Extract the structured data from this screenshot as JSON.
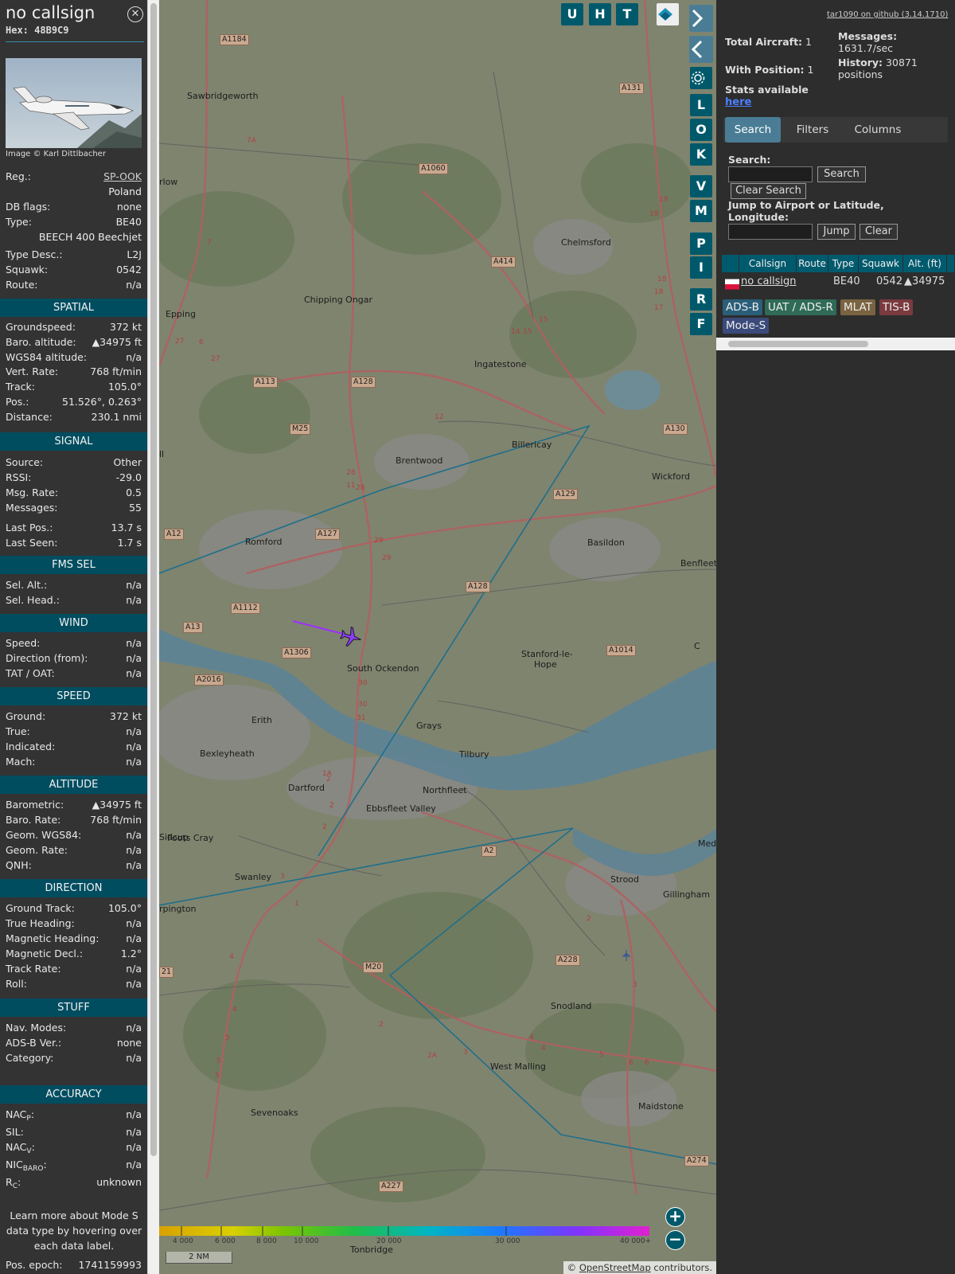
{
  "info": {
    "callsign": "no callsign",
    "hex_label": "Hex:",
    "hex_value": "48B9C9",
    "image_credit": "Image © Karl Dittlbacher",
    "reg_label": "Reg.:",
    "reg_value": "SP-OOK",
    "country": "Poland",
    "dbflags_label": "DB flags:",
    "dbflags_value": "none",
    "type_label": "Type:",
    "type_value": "BE40",
    "type_full": "BEECH 400 Beechjet",
    "typedesc_label": "Type Desc.:",
    "typedesc_value": "L2J",
    "squawk_label": "Squawk:",
    "squawk_value": "0542",
    "route_label": "Route:",
    "route_value": "n/a",
    "sections": {
      "spatial": "SPATIAL",
      "signal": "SIGNAL",
      "fms": "FMS SEL",
      "wind": "WIND",
      "speed": "SPEED",
      "altitude": "ALTITUDE",
      "direction": "DIRECTION",
      "stuff": "STUFF",
      "accuracy": "ACCURACY"
    },
    "spatial": [
      {
        "k": "Groundspeed:",
        "v": "372 kt"
      },
      {
        "k": "Baro. altitude:",
        "v": "▲34975 ft"
      },
      {
        "k": "WGS84 altitude:",
        "v": "n/a"
      },
      {
        "k": "Vert. Rate:",
        "v": "768 ft/min"
      },
      {
        "k": "Track:",
        "v": "105.0°"
      },
      {
        "k": "Pos.:",
        "v": "51.526°, 0.263°"
      },
      {
        "k": "Distance:",
        "v": "230.1 nmi"
      }
    ],
    "signal": [
      {
        "k": "Source:",
        "v": "Other"
      },
      {
        "k": "RSSI:",
        "v": "-29.0"
      },
      {
        "k": "Msg. Rate:",
        "v": "0.5"
      },
      {
        "k": "Messages:",
        "v": "55"
      },
      {
        "k": "Last Pos.:",
        "v": "13.7 s"
      },
      {
        "k": "Last Seen:",
        "v": "1.7 s"
      }
    ],
    "fms": [
      {
        "k": "Sel. Alt.:",
        "v": "n/a"
      },
      {
        "k": "Sel. Head.:",
        "v": "n/a"
      }
    ],
    "wind": [
      {
        "k": "Speed:",
        "v": "n/a"
      },
      {
        "k": "Direction (from):",
        "v": "n/a"
      },
      {
        "k": "TAT / OAT:",
        "v": "n/a"
      }
    ],
    "speed": [
      {
        "k": "Ground:",
        "v": "372 kt"
      },
      {
        "k": "True:",
        "v": "n/a"
      },
      {
        "k": "Indicated:",
        "v": "n/a"
      },
      {
        "k": "Mach:",
        "v": "n/a"
      }
    ],
    "altitude": [
      {
        "k": "Barometric:",
        "v": "▲34975 ft"
      },
      {
        "k": "Baro. Rate:",
        "v": "768 ft/min"
      },
      {
        "k": "Geom. WGS84:",
        "v": "n/a"
      },
      {
        "k": "Geom. Rate:",
        "v": "n/a"
      },
      {
        "k": "QNH:",
        "v": "n/a"
      }
    ],
    "direction": [
      {
        "k": "Ground Track:",
        "v": "105.0°"
      },
      {
        "k": "True Heading:",
        "v": "n/a"
      },
      {
        "k": "Magnetic Heading:",
        "v": "n/a"
      },
      {
        "k": "Magnetic Decl.:",
        "v": "1.2°"
      },
      {
        "k": "Track Rate:",
        "v": "n/a"
      },
      {
        "k": "Roll:",
        "v": "n/a"
      }
    ],
    "stuff": [
      {
        "k": "Nav. Modes:",
        "v": "n/a"
      },
      {
        "k": "ADS-B Ver.:",
        "v": "none"
      },
      {
        "k": "Category:",
        "v": "n/a"
      }
    ],
    "accuracy": {
      "nacp_base": "NAC",
      "nacp_sub": "P",
      "nacp_value": "n/a",
      "sil_label": "SIL:",
      "sil_value": "n/a",
      "nacv_base": "NAC",
      "nacv_sub": "V",
      "nacv_value": "n/a",
      "nic_base": "NIC",
      "nic_sub": "BARO",
      "nic_value": "n/a",
      "rc_base": "R",
      "rc_sub": "C",
      "rc_value": "unknown"
    },
    "learn_more": "Learn more about Mode S data type by hovering over each data label.",
    "posepoch_label": "Pos. epoch:",
    "posepoch_value": "1741159993"
  },
  "map": {
    "top_buttons": [
      "U",
      "H",
      "T"
    ],
    "side_buttons": [
      "L",
      "O",
      "K",
      "V",
      "M",
      "P",
      "I",
      "R",
      "F"
    ],
    "zoom_in": "+",
    "zoom_out": "−",
    "scale_label": "2 NM",
    "altitude_ticks": [
      "4 000",
      "6 000",
      "8 000",
      "10 000",
      "20 000",
      "30 000",
      "40 000+"
    ],
    "attribution_prefix": "© ",
    "attribution_link": "OpenStreetMap",
    "attribution_suffix": " contributors.",
    "places": [
      {
        "name": "Sawbridgeworth"
      },
      {
        "name": "rlow"
      },
      {
        "name": "Chelmsford"
      },
      {
        "name": "Chipping Ongar"
      },
      {
        "name": "Epping"
      },
      {
        "name": "Ingatestone"
      },
      {
        "name": "Billericay"
      },
      {
        "name": "Brentwood"
      },
      {
        "name": "Wickford"
      },
      {
        "name": "ll"
      },
      {
        "name": "Romford"
      },
      {
        "name": "Basildon"
      },
      {
        "name": "Benfleet"
      },
      {
        "name": "South Ockendon"
      },
      {
        "name": "Stanford-le-"
      },
      {
        "name": "Hope"
      },
      {
        "name": "Erith"
      },
      {
        "name": "Grays"
      },
      {
        "name": "Bexleyheath"
      },
      {
        "name": "Tilbury"
      },
      {
        "name": "Dartford"
      },
      {
        "name": "Northfleet"
      },
      {
        "name": "Ebbsfleet Valley"
      },
      {
        "name": "Sidcup"
      },
      {
        "name": "Foots Cray"
      },
      {
        "name": "Swanley"
      },
      {
        "name": "Strood"
      },
      {
        "name": "Gillingham"
      },
      {
        "name": "rpington"
      },
      {
        "name": "Snodland"
      },
      {
        "name": "West Malling"
      },
      {
        "name": "Sevenoaks"
      },
      {
        "name": "Maidstone"
      },
      {
        "name": "Tonbridge"
      },
      {
        "name": "C"
      },
      {
        "name": "Medw"
      }
    ],
    "roads": [
      {
        "name": "A1184"
      },
      {
        "name": "A131"
      },
      {
        "name": "A1060"
      },
      {
        "name": "A414"
      },
      {
        "name": "A113"
      },
      {
        "name": "A128"
      },
      {
        "name": "M25"
      },
      {
        "name": "A130"
      },
      {
        "name": "A129"
      },
      {
        "name": "A12"
      },
      {
        "name": "A127"
      },
      {
        "name": "A128"
      },
      {
        "name": "A1112"
      },
      {
        "name": "A13"
      },
      {
        "name": "A1306"
      },
      {
        "name": "A1014"
      },
      {
        "name": "A2016"
      },
      {
        "name": "A2"
      },
      {
        "name": "M20"
      },
      {
        "name": "A228"
      },
      {
        "name": "A227"
      },
      {
        "name": "A274"
      },
      {
        "name": "21"
      }
    ],
    "junctions": [
      "27",
      "6",
      "27",
      "7",
      "7A",
      "28",
      "11",
      "28",
      "29",
      "29",
      "30",
      "30",
      "31",
      "12",
      "15",
      "15",
      "14",
      "19",
      "19",
      "18",
      "18",
      "17",
      "2",
      "1A",
      "2",
      "2",
      "3",
      "1",
      "4",
      "4",
      "5",
      "5",
      "5",
      "2",
      "2A",
      "3",
      "4",
      "4",
      "6",
      "6",
      "5",
      "3",
      "2"
    ],
    "colors": {
      "track": "#1f6f8b",
      "trail": "#9b30ff",
      "aircraft": "#8e3cff"
    }
  },
  "stats": {
    "github": "tar1090 on github (3.14.1710)",
    "total_label": "Total Aircraft:",
    "total_value": "1",
    "position_label": "With Position:",
    "position_value": "1",
    "messages_label": "Messages:",
    "messages_value": "1631.7/sec",
    "history_label": "History:",
    "history_value": "30871",
    "history_unit": "positions",
    "stats_available": "Stats available",
    "here": "here"
  },
  "tabs": [
    "Search",
    "Filters",
    "Columns"
  ],
  "search": {
    "label": "Search:",
    "button": "Search",
    "clear_button": "Clear Search",
    "jump_label": "Jump to Airport or Latitude, Longitude:",
    "jump_button": "Jump",
    "clear": "Clear"
  },
  "table": {
    "headers": [
      "Callsign",
      "Route",
      "Type",
      "Squawk",
      "Alt. (ft)"
    ],
    "row": {
      "callsign": "no callsign",
      "route": "",
      "type": "BE40",
      "squawk": "0542",
      "alt": "▲34975"
    }
  },
  "sources": [
    {
      "label": "ADS-B",
      "color": "#2a5f7a"
    },
    {
      "label": "UAT / ADS-R",
      "color": "#2f6b57"
    },
    {
      "label": "MLAT",
      "color": "#7a6340"
    },
    {
      "label": "TIS-B",
      "color": "#7a3a3e"
    },
    {
      "label": "Mode-S",
      "color": "#3a4a7a"
    }
  ]
}
